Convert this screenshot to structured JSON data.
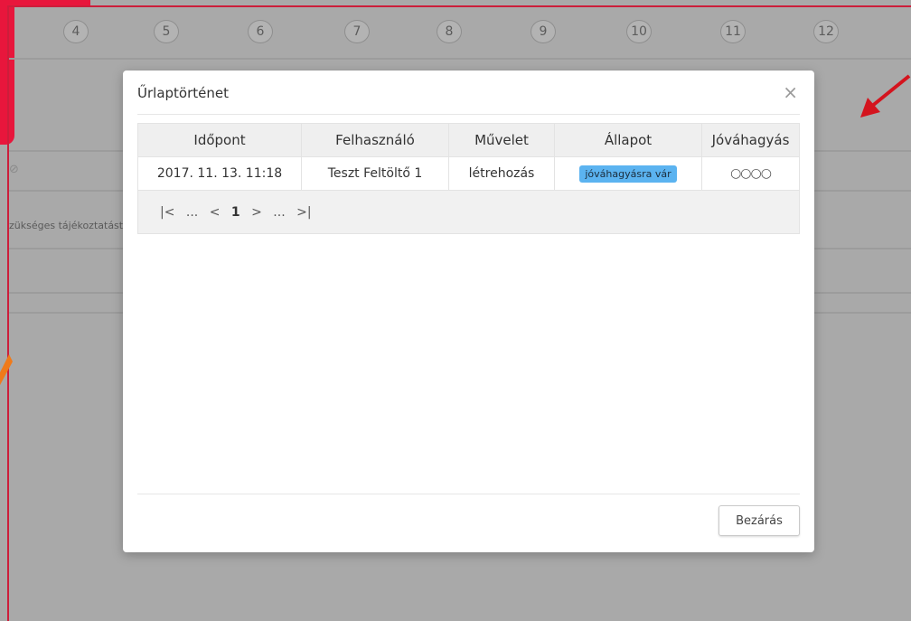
{
  "steps": [
    "4",
    "5",
    "6",
    "7",
    "8",
    "9",
    "10",
    "11",
    "12"
  ],
  "background": {
    "partial_text": "zükséges tájékoztatást"
  },
  "modal": {
    "title": "Űrlaptörténet",
    "close_symbol": "×",
    "table": {
      "headers": [
        "Időpont",
        "Felhasználó",
        "Művelet",
        "Állapot",
        "Jóváhagyás"
      ],
      "rows": [
        {
          "time": "2017. 11. 13. 11:18",
          "user": "Teszt Feltöltő 1",
          "action": "létrehozás",
          "status": "jóváhagyásra vár",
          "approval": "○○○○"
        }
      ]
    },
    "pager": {
      "first": "|<",
      "prev_ellipsis": "...",
      "prev": "<",
      "current": "1",
      "next": ">",
      "next_ellipsis": "...",
      "last": ">|"
    },
    "footer": {
      "close_label": "Bezárás"
    }
  },
  "colors": {
    "overlay_bg": "#a9a9a9",
    "accent_red": "#e8163c",
    "badge_blue": "#5bb3f0",
    "arrow_orange": "#f07a1a"
  }
}
